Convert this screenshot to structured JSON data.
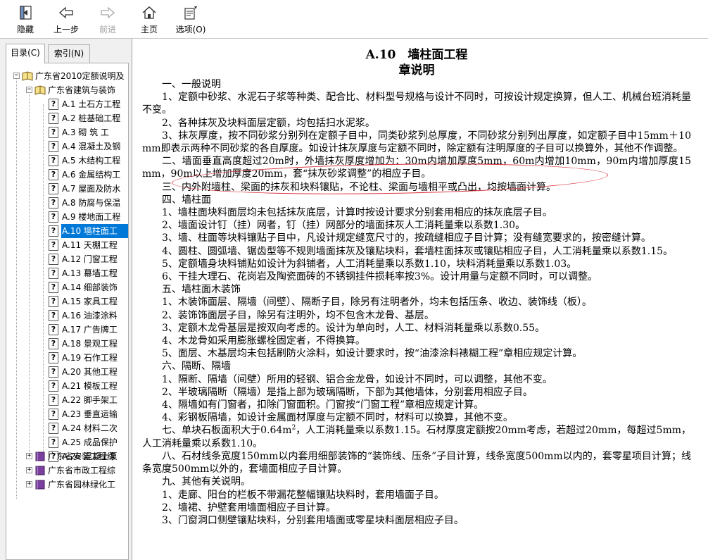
{
  "toolbar": {
    "hide_label": "隐藏",
    "back_label": "上一步",
    "forward_label": "前进",
    "home_label": "主页",
    "options_label": "选项(O)"
  },
  "tabs": {
    "contents_label": "目录(C)",
    "index_label": "索引(N)"
  },
  "tree": {
    "root": "广东省2010定额说明及",
    "building": "广东省建筑与装饰",
    "items": [
      "A.1 土石方工程",
      "A.2 桩基础工程",
      "A.3 砌 筑 工",
      "A.4 混凝土及钢",
      "A.5 木结构工程",
      "A.6 金属结构工",
      "A.7 屋面及防水",
      "A.8 防腐与保温",
      "A.9 楼地面工程",
      "A.10 墙柱面工",
      "A.11 天棚工程",
      "A.12 门窗工程",
      "A.13 幕墙工程",
      "A.14 细部装饰",
      "A.15 家具工程",
      "A.16 油漆涂料",
      "A.17 广告牌工",
      "A.18 景观工程",
      "A.19 石作工程",
      "A.20 其他工程",
      "A.21 模板工程",
      "A.22 脚手架工",
      "A.23 垂直运输",
      "A.24 材料二次",
      "A.25 成品保护",
      "A.26 混凝土泵"
    ],
    "installation": "广东省安装工程综",
    "municipal": "广东省市政工程综",
    "garden": "广东省园林绿化工"
  },
  "doc": {
    "title": "A.10　墙柱面工程",
    "subtitle": "章说明",
    "paragraphs": [
      "一、一般说明",
      "1、定额中砂浆、水泥石子浆等种类、配合比、材料型号规格与设计不同时，可按设计规定换算，但人工、机械台班消耗量不变。",
      "2、各种抹灰及块料面层定额，均包括扫水泥浆。",
      "3、抹灰厚度，按不同砂浆分别列在定额子目中，同类砂浆列总厚度，不同砂浆分别列出厚度，如定额子目中15mm＋10mm即表示两种不同砂浆的各自厚度。如设计抹灰厚度与定额不同时，除定额有注明厚度的子目可以换算外，其他不作调整。",
      "二、墙面垂直高度超过20m时，外墙抹灰厚度增加为：30m内增加厚度5mm，60m内增加10mm，90m内增加厚度15mm，90m以上增加厚度20mm，套“抹灰砂浆调整”的相应子目。",
      "三、内外附墙柱、梁面的抹灰和块料镶贴，不论柱、梁面与墙相平或凸出，均按墙面计算。",
      "四、墙柱面",
      "1、墙柱面块料面层均未包括抹灰底层，计算时按设计要求分别套用相应的抹灰底层子目。",
      "2、墙面设计钉（挂）网者，钉（挂）网部分的墙面抹灰人工消耗量乘以系数1.30。",
      "3、墙、柱面等块料镶贴子目中，凡设计规定缝宽尺寸的，按疏缝相应子目计算；没有缝宽要求的，按密缝计算。",
      "4、圆柱、圆弧墙、锯齿型等不规则墙面抹灰及镶贴块料，套墙柱面抹灰或镶贴相应子目，人工消耗量乘以系数1.15。",
      "5、定额墙身块料铺贴如设计为斜铺者，人工消耗量乘以系数1.10，块料消耗量乘以系数1.03。",
      "6、干挂大理石、花岗岩及陶瓷面砖的不锈钢挂件损耗率按3%。设计用量与定额不同时，可以调整。",
      "五、墙柱面木装饰",
      "1、木装饰面层、隔墙（间壁）、隔断子目，除另有注明者外，均未包括压条、收边、装饰线（板）。",
      "2、装饰饰面层子目，除另有注明外，均不包含木龙骨、基层。",
      "3、定额木龙骨基层是按双向考虑的。设计为单向时，人工、材料消耗量乘以系数0.55。",
      "4、木龙骨如采用膨胀螺栓固定者，不得换算。",
      "5、面层、木基层均未包括刷防火涂料，如设计要求时，按“油漆涂料裱糊工程”章相应规定计算。",
      "六、隔断、隔墙",
      "1、隔断、隔墙（间壁）所用的轻钢、铝合金龙骨，如设计不同时，可以调整，其他不变。",
      "2、半玻璃隔断（隔墙）是指上部为玻璃隔断，下部为其他墙体，分别套用相应子目。",
      "4、隔墙如有门窗者，扣除门窗面积。门窗按“门窗工程”章相应规定计算。",
      "4、彩钢板隔墙，如设计金属面材厚度与定额不同时，材料可以换算，其他不变。"
    ],
    "p7_before": "七、单块石板面积大于0.64m",
    "p7_sup": "2",
    "p7_after": "，人工消耗量乘以系数1.15。石材厚度定额按20mm考虑，若超过20mm，每超过5mm，人工消耗量乘以系数1.10。",
    "paragraphs2": [
      "八、石材线条宽度150mm以内套用细部装饰的“装饰线、压条”子目计算，线条宽度500mm以内的，套零星项目计算；线条宽度500mm以外的，套墙面相应子目计算。",
      "九、其他有关说明。",
      "1、走廊、阳台的栏板不带漏花整幅镶贴块料时，套用墙面子目。",
      "2、墙裙、护壁套用墙面相应子目计算。",
      "3、门窗洞口侧壁镶贴块料，分别套用墙面或零星块料面层相应子目。"
    ]
  },
  "colors": {
    "selection": "#0078d7",
    "annotation": "#d9363e"
  }
}
